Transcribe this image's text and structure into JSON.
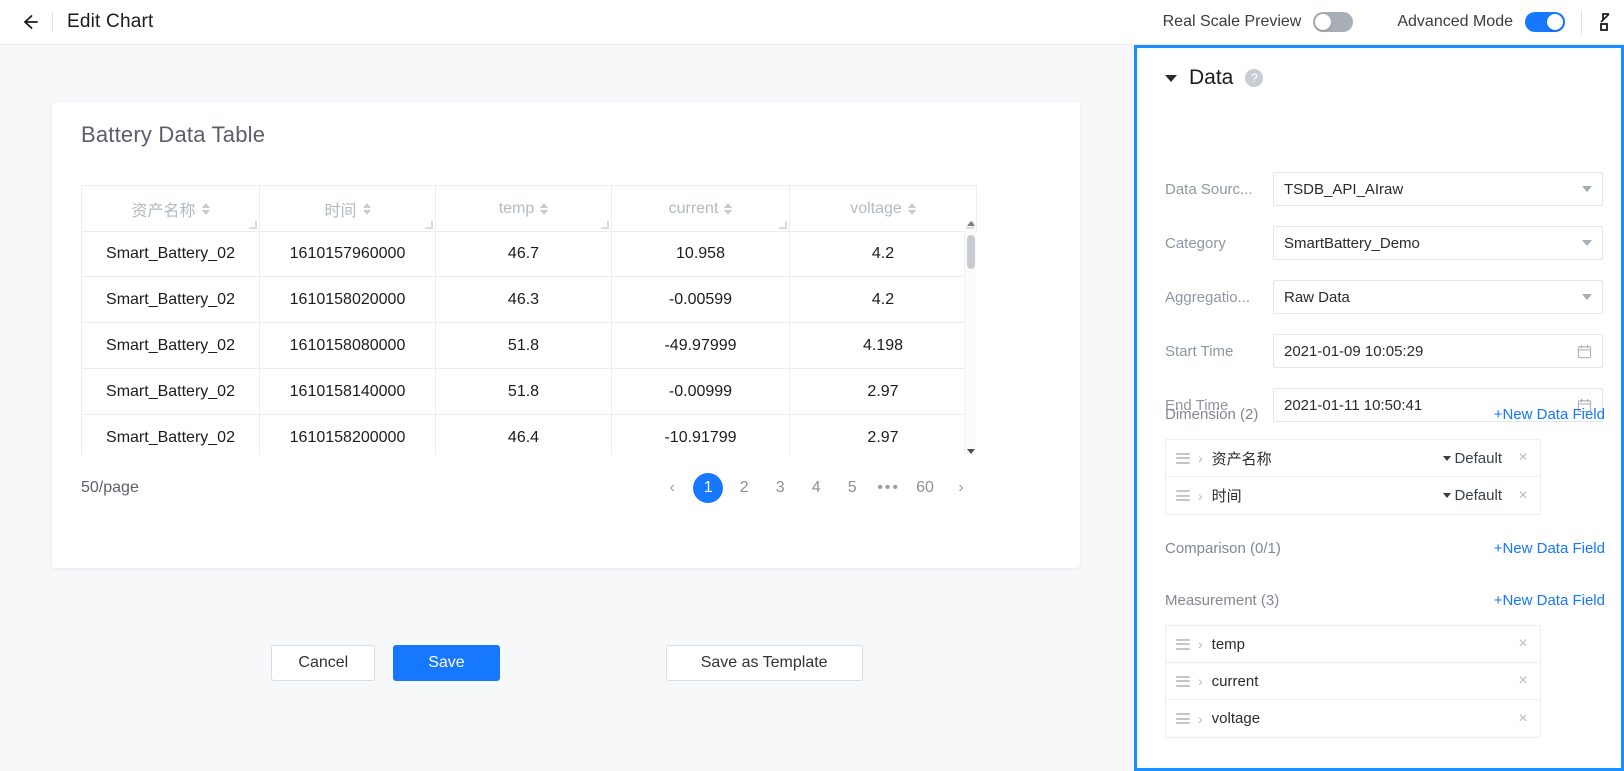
{
  "header": {
    "back_icon": "arrow-left-icon",
    "title": "Edit Chart",
    "real_scale_preview_label": "Real Scale Preview",
    "real_scale_preview_state": "off",
    "advanced_mode_label": "Advanced Mode",
    "advanced_mode_state": "on",
    "expand_icon": "fullscreen-expand-icon"
  },
  "colors": {
    "accent": "#1677ff",
    "panel_border": "#1890ff",
    "toggle_off": "#a9adb5",
    "page_bg": "#f7f8fa"
  },
  "chart_card": {
    "title": "Battery Data Table",
    "table": {
      "columns": [
        {
          "label": "资产名称",
          "sortable": true
        },
        {
          "label": "时间",
          "sortable": true
        },
        {
          "label": "temp",
          "sortable": true
        },
        {
          "label": "current",
          "sortable": true
        },
        {
          "label": "voltage",
          "sortable": true
        }
      ],
      "rows": [
        [
          "Smart_Battery_02",
          "1610157960000",
          "46.7",
          "10.958",
          "4.2"
        ],
        [
          "Smart_Battery_02",
          "1610158020000",
          "46.3",
          "-0.00599",
          "4.2"
        ],
        [
          "Smart_Battery_02",
          "1610158080000",
          "51.8",
          "-49.97999",
          "4.198"
        ],
        [
          "Smart_Battery_02",
          "1610158140000",
          "51.8",
          "-0.00999",
          "2.97"
        ],
        [
          "Smart_Battery_02",
          "1610158200000",
          "46.4",
          "-10.91799",
          "2.97"
        ]
      ]
    },
    "pagination": {
      "page_size": "50/page",
      "prev": "‹",
      "next": "›",
      "pages": [
        "1",
        "2",
        "3",
        "4",
        "5"
      ],
      "ellipsis": "•••",
      "last_page": "60",
      "current": "1"
    }
  },
  "footer": {
    "cancel_label": "Cancel",
    "save_label": "Save",
    "save_as_template_label": "Save as Template"
  },
  "panel": {
    "title": "Data",
    "help_icon": "question-mark-icon",
    "collapse_icon": "chevron-down-icon",
    "fields": [
      {
        "label": "Data Sourc...",
        "value": "TSDB_API_AIraw",
        "control": "select"
      },
      {
        "label": "Category",
        "value": "SmartBattery_Demo",
        "control": "select"
      },
      {
        "label": "Aggregatio...",
        "value": "Raw Data",
        "control": "select"
      },
      {
        "label": "Start Time",
        "value": "2021-01-09 10:05:29",
        "control": "date"
      },
      {
        "label": "End Time",
        "value": "2021-01-11 10:50:41",
        "control": "date"
      }
    ],
    "sections": [
      {
        "title": "Dimension (2)",
        "add_label": "+New Data Field",
        "items": [
          {
            "name": "资产名称",
            "aggregation": "Default",
            "has_aggregation": true
          },
          {
            "name": "时间",
            "aggregation": "Default",
            "has_aggregation": true
          }
        ]
      },
      {
        "title": "Comparison (0/1)",
        "add_label": "+New Data Field",
        "items": []
      },
      {
        "title": "Measurement (3)",
        "add_label": "+New Data Field",
        "items": [
          {
            "name": "temp",
            "has_aggregation": false
          },
          {
            "name": "current",
            "has_aggregation": false
          },
          {
            "name": "voltage",
            "has_aggregation": false
          }
        ]
      }
    ],
    "remove_icon": "close-x-icon",
    "drag_icon": "drag-handle-icon",
    "expand_icon": "chevron-right-icon"
  }
}
